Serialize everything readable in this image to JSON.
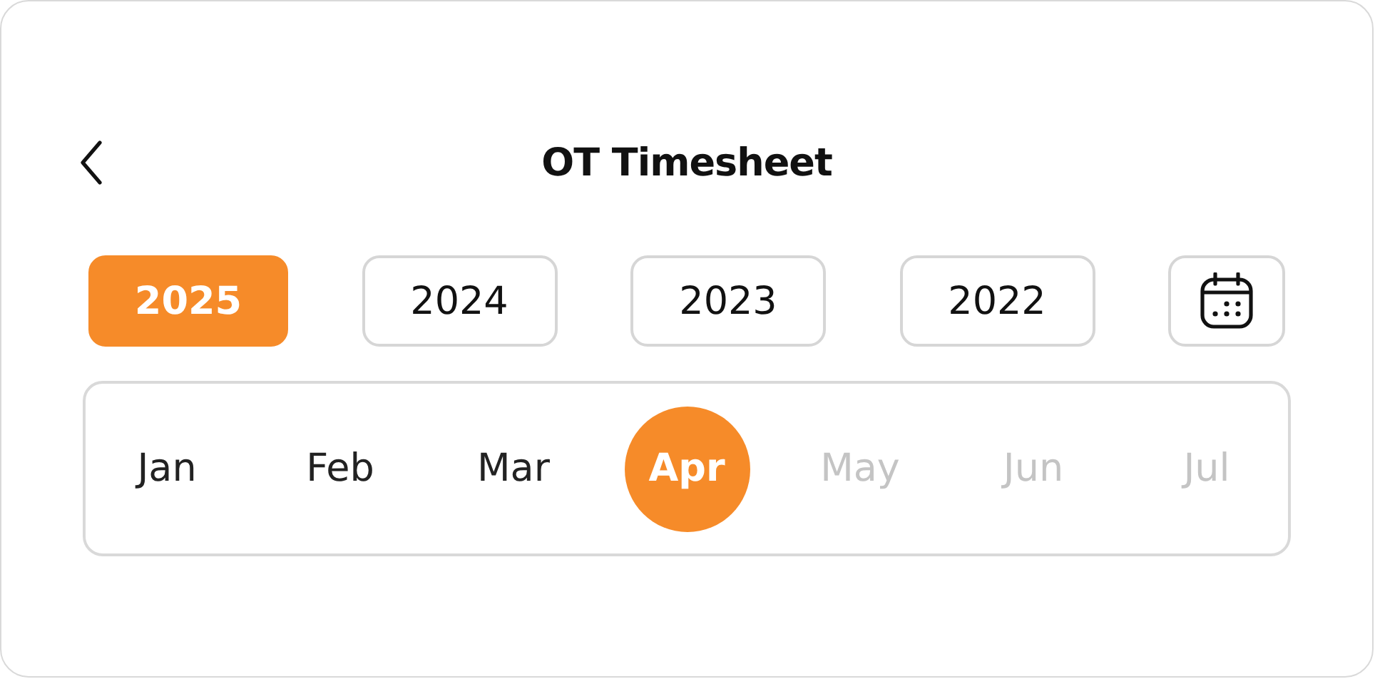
{
  "header": {
    "title": "OT Timesheet"
  },
  "years": [
    {
      "label": "2025",
      "selected": true
    },
    {
      "label": "2024",
      "selected": false
    },
    {
      "label": "2023",
      "selected": false
    },
    {
      "label": "2022",
      "selected": false
    }
  ],
  "months": [
    {
      "label": "Jan",
      "selected": false,
      "disabled": false
    },
    {
      "label": "Feb",
      "selected": false,
      "disabled": false
    },
    {
      "label": "Mar",
      "selected": false,
      "disabled": false
    },
    {
      "label": "Apr",
      "selected": true,
      "disabled": false
    },
    {
      "label": "May",
      "selected": false,
      "disabled": true
    },
    {
      "label": "Jun",
      "selected": false,
      "disabled": true
    },
    {
      "label": "Jul",
      "selected": false,
      "disabled": true
    }
  ]
}
